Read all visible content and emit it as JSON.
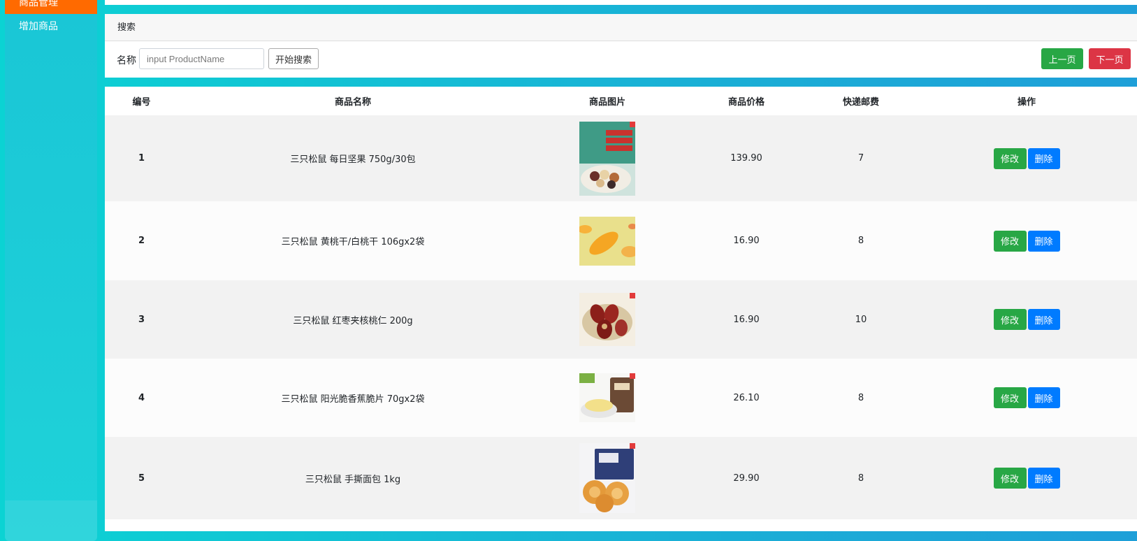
{
  "sidebar": {
    "active_item": "商品管理",
    "items": [
      {
        "label": "增加商品"
      }
    ]
  },
  "search": {
    "header": "搜索",
    "name_label": "名称",
    "input_placeholder": "input ProductName",
    "input_value": "",
    "search_button": "开始搜索",
    "prev_button": "上一页",
    "next_button": "下一页"
  },
  "table": {
    "columns": [
      "编号",
      "商品名称",
      "商品图片",
      "商品价格",
      "快递邮费",
      "操作"
    ],
    "edit_label": "修改",
    "delete_label": "删除",
    "rows": [
      {
        "id": "1",
        "name": "三只松鼠 每日坚果 750g/30包",
        "price": "139.90",
        "shipping": "7",
        "image": "nut-gift-box"
      },
      {
        "id": "2",
        "name": "三只松鼠 黄桃干/白桃干 106gx2袋",
        "price": "16.90",
        "shipping": "8",
        "image": "dried-peach"
      },
      {
        "id": "3",
        "name": "三只松鼠 红枣夹核桃仁 200g",
        "price": "16.90",
        "shipping": "10",
        "image": "jujube-walnut"
      },
      {
        "id": "4",
        "name": "三只松鼠 阳光脆香蕉脆片 70gx2袋",
        "price": "26.10",
        "shipping": "8",
        "image": "banana-chips"
      },
      {
        "id": "5",
        "name": "三只松鼠 手撕面包 1kg",
        "price": "29.90",
        "shipping": "8",
        "image": "hand-torn-bread"
      }
    ]
  }
}
